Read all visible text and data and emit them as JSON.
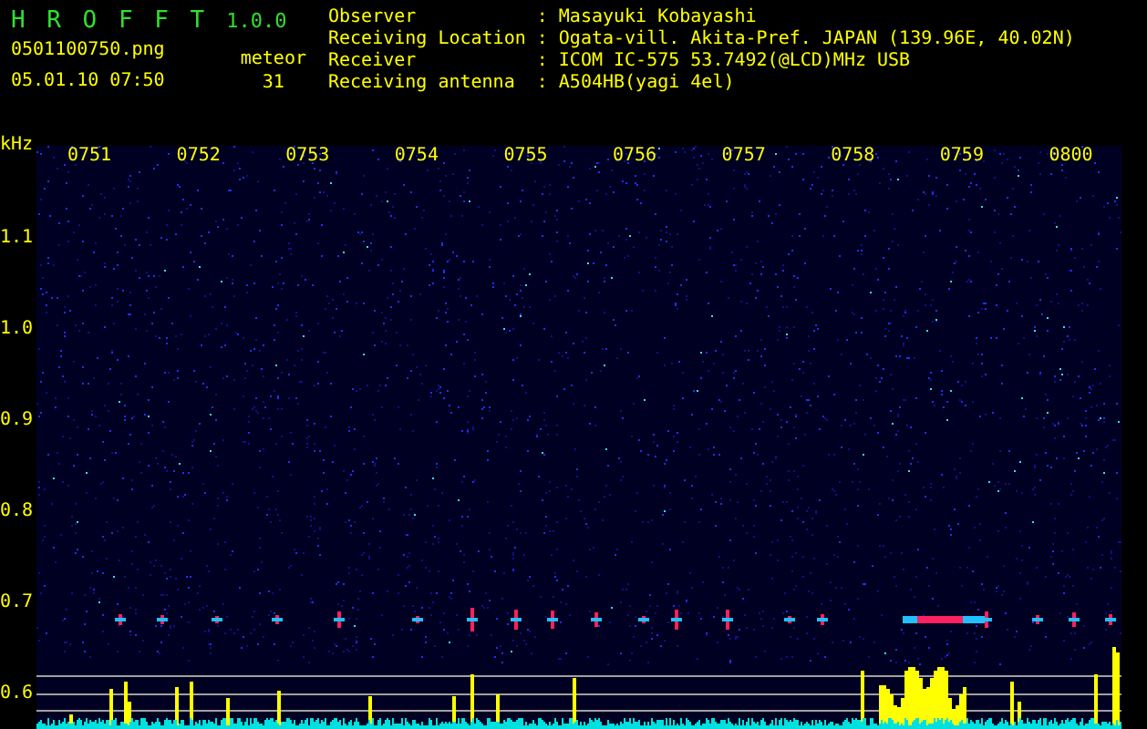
{
  "app": {
    "title": "H R O F F T",
    "version": "1.0.0"
  },
  "file": {
    "name": "0501100750.png",
    "timestamp": "05.01.10 07:50"
  },
  "meteor": {
    "label": "meteor",
    "count": "31"
  },
  "station": [
    {
      "label": "Observer",
      "separator": ":",
      "value": "Masayuki Kobayashi"
    },
    {
      "label": "Receiving Location",
      "separator": ":",
      "value": "Ogata-vill. Akita-Pref. JAPAN (139.96E, 40.02N)"
    },
    {
      "label": "Receiver",
      "separator": ":",
      "value": "ICOM IC-575 53.7492(@LCD)MHz USB"
    },
    {
      "label": "Receiving antenna",
      "separator": ":",
      "value": "A504HB(yagi 4el)"
    }
  ],
  "spectrogram": {
    "unit": "kHz",
    "frequency_labels": [
      "1.1",
      "1.0",
      "0.9",
      "0.8",
      "0.7",
      "0.6"
    ],
    "time_labels": [
      "0751",
      "0752",
      "0753",
      "0754",
      "0755",
      "0756",
      "0757",
      "0758",
      "0759",
      "0800"
    ]
  }
}
